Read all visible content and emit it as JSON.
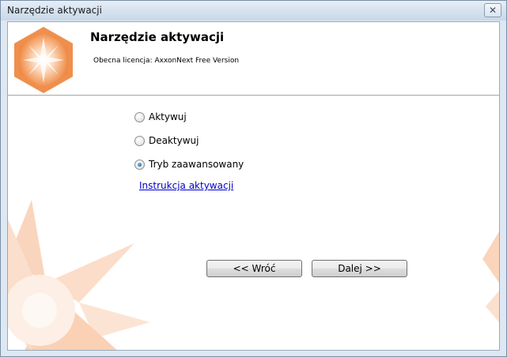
{
  "window": {
    "title": "Narzędzie aktywacji",
    "close_glyph": "✕"
  },
  "header": {
    "title": "Narzędzie aktywacji",
    "license_label": "Obecna licencja:",
    "license_value": "AxxonNext Free Version"
  },
  "options": [
    {
      "label": "Aktywuj",
      "selected": false
    },
    {
      "label": "Deaktywuj",
      "selected": false
    },
    {
      "label": "Tryb zaawansowany",
      "selected": true
    }
  ],
  "link_label": "Instrukcja aktywacji",
  "buttons": {
    "back": "<< Wróć",
    "next": "Dalej >>"
  },
  "colors": {
    "accent_orange": "#f5a66b",
    "link": "#0000cc"
  }
}
